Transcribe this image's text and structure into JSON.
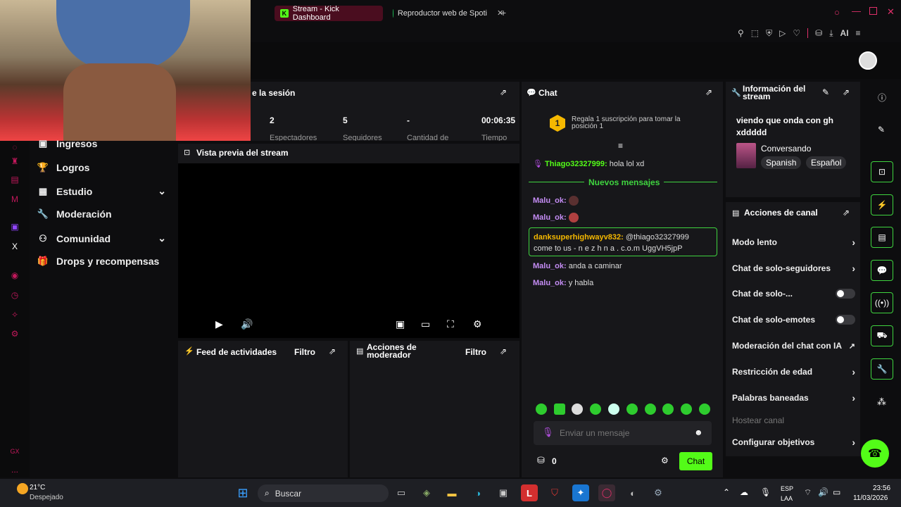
{
  "browser": {
    "tabs": [
      {
        "label": "Stream - Kick Dashboard",
        "active": true
      },
      {
        "label": "Reproductor web de Spoti",
        "active": false
      }
    ],
    "new_tab": "+",
    "ai_label": "AI"
  },
  "session": {
    "title": "e la sesión",
    "stats": [
      {
        "value": "2",
        "label": "Espectadores"
      },
      {
        "value": "5",
        "label": "Seguidores"
      },
      {
        "value": "-",
        "label": "Cantidad de"
      },
      {
        "value": "00:06:35",
        "label": "Tiempo"
      }
    ]
  },
  "sidebar": {
    "items": [
      {
        "label": "Ingresos",
        "chevron": false
      },
      {
        "label": "Logros",
        "chevron": false
      },
      {
        "label": "Estudio",
        "chevron": true
      },
      {
        "label": "Moderación",
        "chevron": false
      },
      {
        "label": "Comunidad",
        "chevron": true
      },
      {
        "label": "Drops y recompensas",
        "chevron": false
      }
    ],
    "gx_label": "GX",
    "more_label": "..."
  },
  "preview": {
    "title": "Vista previa del stream"
  },
  "activity": {
    "title": "Feed de actividades",
    "filter": "Filtro"
  },
  "mod_actions": {
    "title": "Acciones de moderador",
    "filter": "Filtro"
  },
  "chat": {
    "title": "Chat",
    "gift_badge": "1",
    "gift_text": "Regala 1 suscripción para tomar la posición 1",
    "messages_top": [
      {
        "user": "Thiago32327999:",
        "text": "hola lol xd"
      }
    ],
    "new_messages": "Nuevos mensajes",
    "emote_lines": [
      {
        "user": "Malu_ok:"
      },
      {
        "user": "Malu_ok:"
      }
    ],
    "highlight": {
      "user": "danksuperhighwayv832:",
      "text": "@thiago32327999",
      "text2": "come to us - n e z h n a . c.o.m UggVH5jpP"
    },
    "messages_bottom": [
      {
        "user": "Malu_ok:",
        "text": "anda a caminar"
      },
      {
        "user": "Malu_ok:",
        "text": "y habla"
      }
    ],
    "input_placeholder": "Enviar un mensaje",
    "points": "0",
    "send": "Chat"
  },
  "stream_info": {
    "title": "Información del stream",
    "stream_title": "viendo que onda con gh xddddd",
    "category": "Conversando",
    "tags": [
      "Spanish",
      "Español"
    ]
  },
  "channel_actions": {
    "title": "Acciones de canal",
    "items": [
      {
        "label": "Modo lento",
        "control": "chevron"
      },
      {
        "label": "Chat de solo-seguidores",
        "control": "chevron"
      },
      {
        "label": "Chat de solo-...",
        "control": "toggle"
      },
      {
        "label": "Chat de solo-emotes",
        "control": "toggle"
      },
      {
        "label": "Moderación del chat con IA",
        "control": "external"
      },
      {
        "label": "Restricción de edad",
        "control": "chevron"
      },
      {
        "label": "Palabras baneadas",
        "control": "chevron"
      }
    ],
    "host_label": "Hostear canal",
    "goals_label": "Configurar objetivos"
  },
  "taskbar": {
    "weather_temp": "21°C",
    "weather_desc": "Despejado",
    "search": "Buscar",
    "lang1": "ESP",
    "lang2": "LAA",
    "time": "23:56",
    "date": "11/03/2026"
  },
  "colors": {
    "accent": "#53fc18",
    "kick_green": "#3fd43f",
    "opera_red": "#c2185b",
    "username": "#c58df5"
  }
}
